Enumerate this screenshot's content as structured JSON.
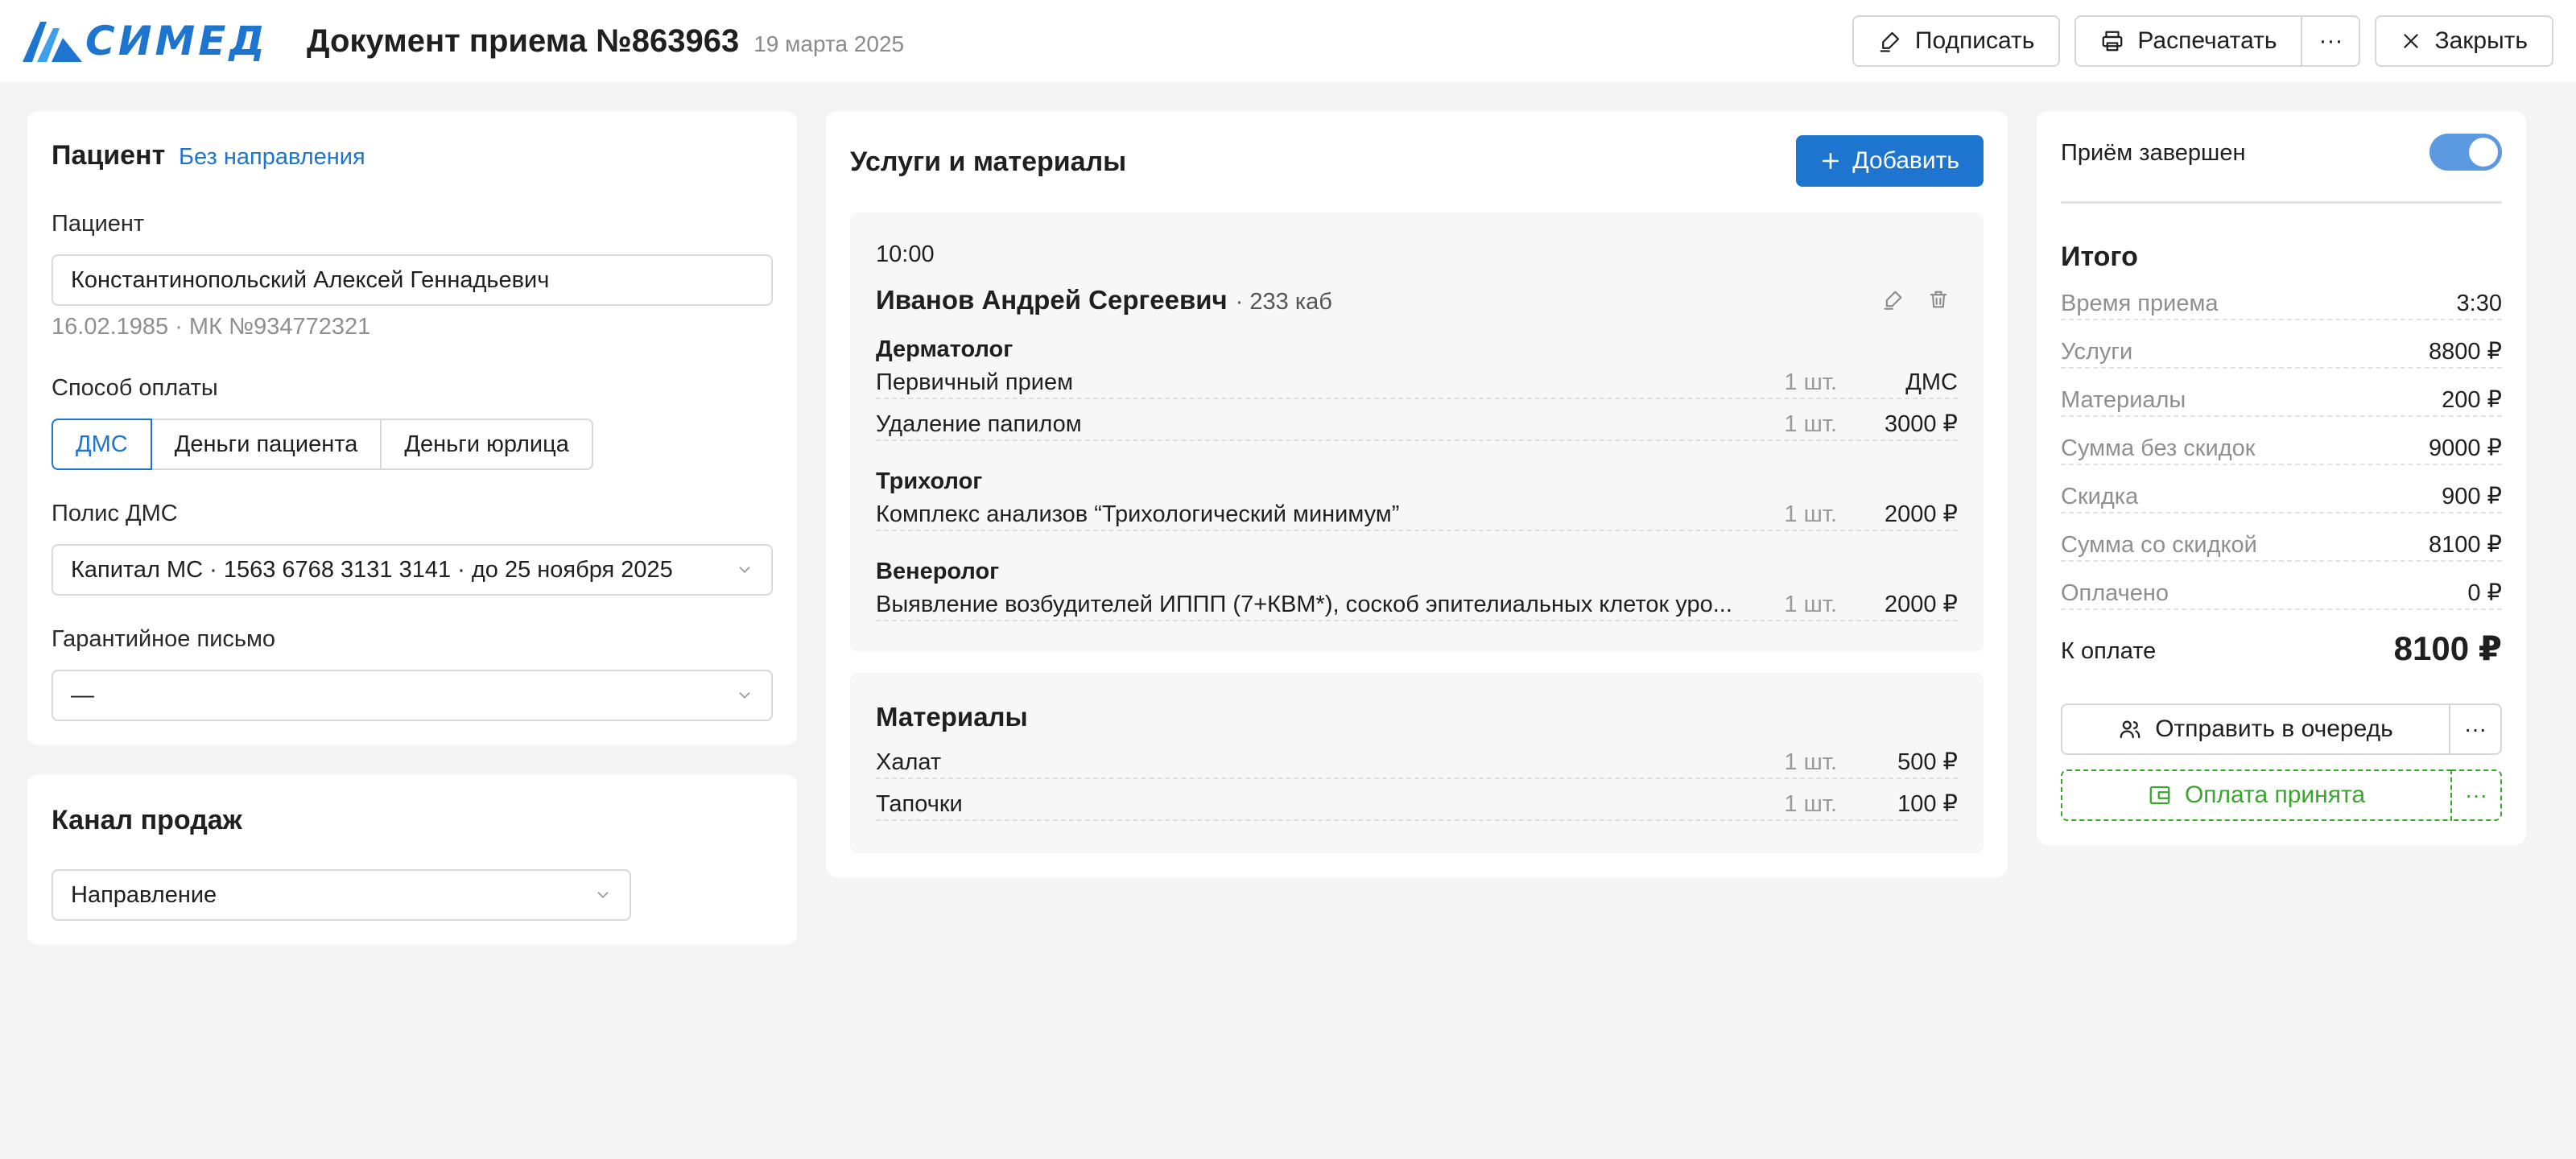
{
  "header": {
    "logo_text": "СИМЕД",
    "title": "Документ приема №863963",
    "date": "19 марта 2025",
    "actions": {
      "sign": "Подписать",
      "print": "Распечатать",
      "more": "···",
      "close": "Закрыть"
    }
  },
  "patient_card": {
    "title": "Пациент",
    "referral_link": "Без направления",
    "patient_label": "Пациент",
    "patient_value": "Константинопольский Алексей Геннадьевич",
    "patient_meta": "16.02.1985 · МК №934772321",
    "payment_label": "Способ оплаты",
    "payment_options": [
      "ДМС",
      "Деньги пациента",
      "Деньги юрлица"
    ],
    "payment_selected": "ДМС",
    "policy_label": "Полис ДМС",
    "policy_value": "Капитал МС · 1563 6768 3131 3141 · до 25 ноября 2025",
    "guarantee_label": "Гарантийное письмо",
    "guarantee_value": "—"
  },
  "sales_card": {
    "title": "Канал продаж",
    "value": "Направление"
  },
  "services_card": {
    "title": "Услуги и материалы",
    "add_label": "Добавить",
    "visit": {
      "time": "10:00",
      "doctor": "Иванов Андрей Сергеевич",
      "room": "· 233 каб",
      "groups": [
        {
          "specialty": "Дерматолог",
          "items": [
            {
              "name": "Первичный прием",
              "qty": "1 шт.",
              "price": "ДМС"
            },
            {
              "name": "Удаление папилом",
              "qty": "1 шт.",
              "price": "3000 ₽"
            }
          ]
        },
        {
          "specialty": "Трихолог",
          "items": [
            {
              "name": "Комплекс анализов “Трихологический минимум”",
              "qty": "1 шт.",
              "price": "2000 ₽"
            }
          ]
        },
        {
          "specialty": "Венеролог",
          "items": [
            {
              "name": "Выявление возбудителей ИППП (7+КВМ*), соскоб эпителиальных клеток уро...",
              "qty": "1 шт.",
              "price": "2000 ₽"
            }
          ]
        }
      ]
    },
    "materials": {
      "title": "Материалы",
      "items": [
        {
          "name": "Халат",
          "qty": "1 шт.",
          "price": "500 ₽"
        },
        {
          "name": "Тапочки",
          "qty": "1 шт.",
          "price": "100 ₽"
        }
      ]
    }
  },
  "summary_card": {
    "completed_label": "Приём завершен",
    "completed": true,
    "title": "Итого",
    "rows": [
      {
        "k": "Время приема",
        "v": "3:30"
      },
      {
        "k": "Услуги",
        "v": "8800 ₽"
      },
      {
        "k": "Материалы",
        "v": "200 ₽"
      },
      {
        "k": "Сумма без скидок",
        "v": "9000 ₽"
      },
      {
        "k": "Скидка",
        "v": "900 ₽"
      },
      {
        "k": "Сумма со скидкой",
        "v": "8100 ₽"
      },
      {
        "k": "Оплачено",
        "v": "0 ₽"
      }
    ],
    "to_pay_label": "К оплате",
    "to_pay_value": "8100 ₽",
    "queue_button": "Отправить в очередь",
    "paid_button": "Оплата принята",
    "more": "···"
  },
  "colors": {
    "brand": "#1d75cf",
    "success": "#3aa52e",
    "toggle_on": "#5b9ae0"
  }
}
